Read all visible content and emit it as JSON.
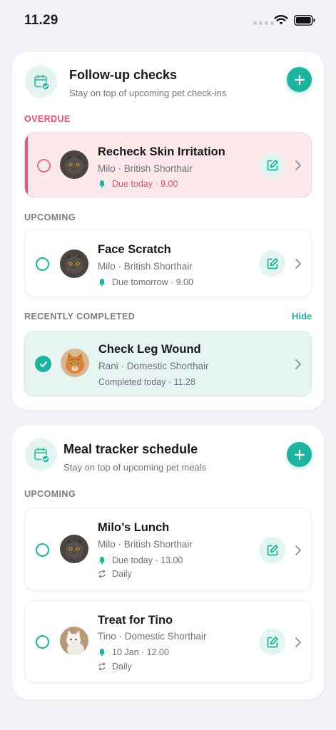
{
  "status_bar": {
    "time": "11.29"
  },
  "followup": {
    "title": "Follow-up checks",
    "subtitle": "Stay on top of upcoming pet check-ins",
    "overdue_label": "OVERDUE",
    "upcoming_label": "UPCOMING",
    "completed_label": "RECENTLY COMPLETED",
    "hide_label": "Hide",
    "overdue_items": [
      {
        "title": "Recheck Skin Irritation",
        "pet": "Milo · British Shorthair",
        "due": "Due today · 9.00"
      }
    ],
    "upcoming_items": [
      {
        "title": "Face Scratch",
        "pet": "Milo · British Shorthair",
        "due": "Due tomorrow · 9.00"
      }
    ],
    "completed_items": [
      {
        "title": "Check Leg Wound",
        "pet": "Rani · Domestic Shorthair",
        "status": "Completed today · 11.28"
      }
    ]
  },
  "meals": {
    "title": "Meal tracker schedule",
    "subtitle": "Stay on top of upcoming pet meals",
    "upcoming_label": "UPCOMING",
    "items": [
      {
        "title": "Milo’s Lunch",
        "pet": "Milo · British Shorthair",
        "due": "Due today · 13.00",
        "repeat": "Daily"
      },
      {
        "title": "Treat for Tino",
        "pet": "Tino · Domestic Shorthair",
        "due": "10 Jan · 12.00",
        "repeat": "Daily"
      }
    ]
  },
  "colors": {
    "accent": "#1db39e",
    "overdue": "#df5a74",
    "background": "#f2f3f7"
  },
  "icons": [
    "calendar-check-icon",
    "plus-icon",
    "edit-icon",
    "chevron-right-icon",
    "bell-icon",
    "repeat-icon",
    "checkmark-icon",
    "wifi-icon",
    "battery-icon"
  ]
}
